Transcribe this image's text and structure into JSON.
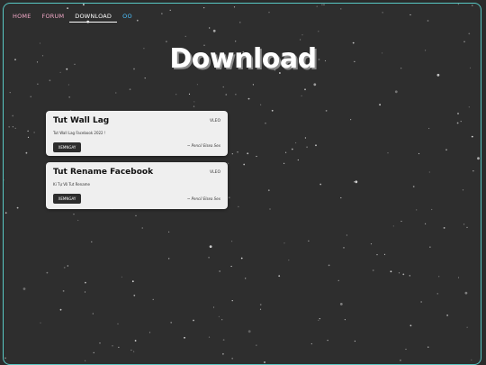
{
  "nav": {
    "items": [
      {
        "label": "HOME"
      },
      {
        "label": "FORUM"
      },
      {
        "label": "DOWNLOAD"
      },
      {
        "label": "OO"
      }
    ]
  },
  "hero": {
    "title": "Download"
  },
  "cards": [
    {
      "title": "Tut Wall Lag",
      "tag": "VLEO",
      "description": "Tut Wall Lag Facebook 2022 !",
      "button_label": "XEMNGAY",
      "author": "~ Pencil Elsea Sex"
    },
    {
      "title": "Tut Rename Facebook",
      "tag": "VLEO",
      "description": "Ki Tự Vô Tut Rename",
      "button_label": "XEMNGAY",
      "author": "~ Pencil Elsea Sex"
    }
  ],
  "colors": {
    "background": "#2b2b2b",
    "frame_border": "#58c8c4",
    "nav_link": "#f3a9c8",
    "nav_extra": "#4cc2ff",
    "card": "#efefef"
  }
}
